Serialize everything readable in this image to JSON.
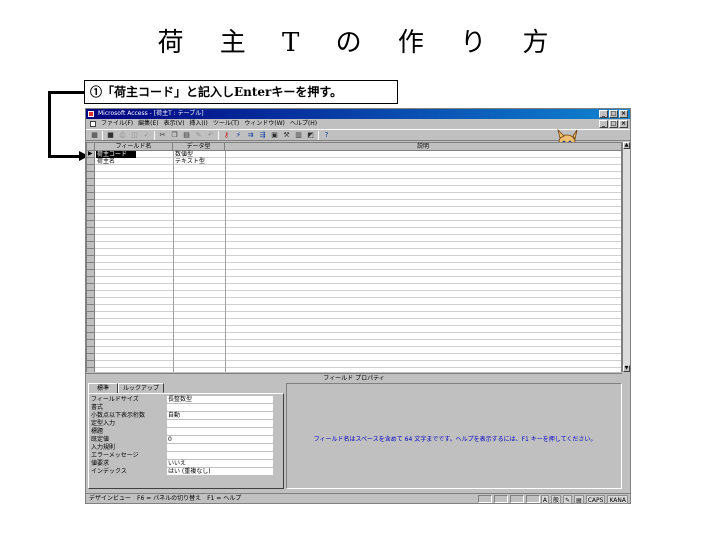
{
  "slide": {
    "title": "荷 主 T の 作 り 方",
    "callout": "①「荷主コード」と記入しEnterキーを押す。"
  },
  "window": {
    "title": "Microsoft Access - [荷主T : テーブル]",
    "controls": [
      "_",
      "□",
      "×"
    ]
  },
  "menubar": {
    "items": [
      "ファイル(F)",
      "編集(E)",
      "表示(V)",
      "挿入(I)",
      "ツール(T)",
      "ウィンドウ(W)",
      "ヘルプ(H)"
    ]
  },
  "toolbar": {
    "icons": [
      "view-icon",
      "save-icon",
      "print-icon",
      "preview-icon",
      "spell-icon",
      "cut-icon",
      "copy-icon",
      "paste-icon",
      "format-painter-icon",
      "undo-icon",
      "primary-key-icon",
      "indexes-icon",
      "insert-row-icon",
      "delete-row-icon",
      "properties-icon",
      "build-icon",
      "database-window-icon",
      "new-object-icon",
      "help-icon"
    ]
  },
  "grid": {
    "headers": {
      "field_name": "フィールド名",
      "data_type": "データ型",
      "description": "説明"
    },
    "rows": [
      {
        "field_name": "荷主コード",
        "data_type": "数値型",
        "selected": true,
        "key": true
      },
      {
        "field_name": "荷主名",
        "data_type": "テキスト型",
        "selected": false,
        "key": false
      }
    ]
  },
  "properties": {
    "header": "フィールド プロパティ",
    "tabs": [
      "標準",
      "ルックアップ"
    ],
    "rows": [
      {
        "label": "フィールドサイズ",
        "value": "長整数型"
      },
      {
        "label": "書式",
        "value": ""
      },
      {
        "label": "小数点以下表示桁数",
        "value": "自動"
      },
      {
        "label": "定型入力",
        "value": ""
      },
      {
        "label": "標題",
        "value": ""
      },
      {
        "label": "既定値",
        "value": "0"
      },
      {
        "label": "入力規則",
        "value": ""
      },
      {
        "label": "エラーメッセージ",
        "value": ""
      },
      {
        "label": "値要求",
        "value": "いいえ"
      },
      {
        "label": "インデックス",
        "value": "はい (重複なし)"
      }
    ],
    "hint": "フィールド名はスペースを含めて 64 文字までです。ヘルプを表示するには、F1 キーを押してください。"
  },
  "statusbar": {
    "text": "デザインビュー　F6 = パネルの切り替え　F1 = ヘルプ",
    "ime": [
      "A",
      "般",
      "CAPS",
      "KANA"
    ]
  }
}
